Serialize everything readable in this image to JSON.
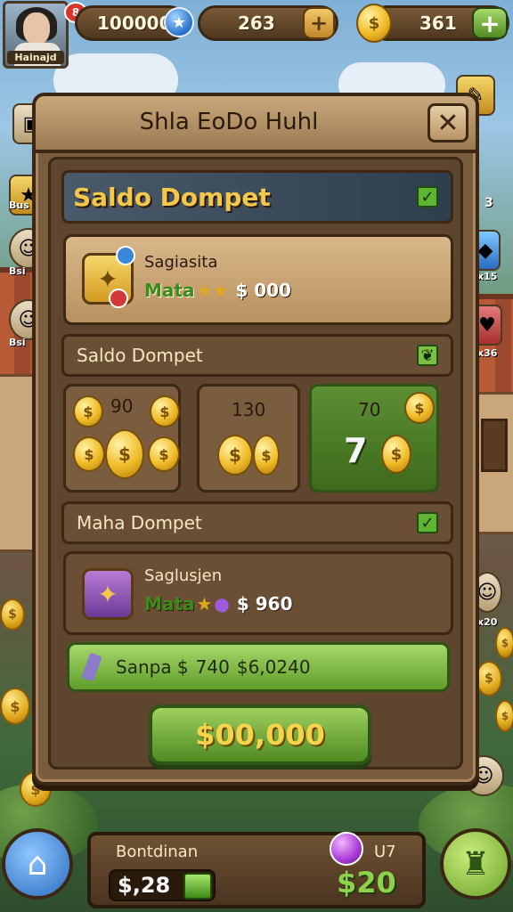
{
  "player": {
    "name": "Hainajd",
    "notification": "8"
  },
  "hud": {
    "currency_1": "100000",
    "currency_2": "263",
    "currency_3": "361",
    "add_label": "+"
  },
  "side_labels": {
    "left_1": "Bus",
    "left_2": "Bsi",
    "left_3": "Bsi",
    "right_1": "3",
    "right_2": "x15",
    "right_3": "x36",
    "right_4": "x20"
  },
  "panel": {
    "title": "Shla EoDo Huhl",
    "close_label": "✕"
  },
  "header_section": {
    "title": "Saldo Dompet"
  },
  "card_1": {
    "name": "Sagiasita",
    "sub_label": "Mata",
    "amount": "$ 000"
  },
  "section_2": {
    "title": "Saldo Dompet"
  },
  "packs": [
    {
      "value": "90"
    },
    {
      "value": "130"
    },
    {
      "value": "70",
      "big_value": "7"
    }
  ],
  "section_3": {
    "title": "Maha Dompet"
  },
  "card_2": {
    "name": "Saglusjen",
    "sub_label": "Mata",
    "amount": "$ 960"
  },
  "summary_bar": {
    "label": "Sanpa $",
    "value_1": "740",
    "value_2": "$6,0240"
  },
  "confirm_button": {
    "label": "$00,000"
  },
  "bottom": {
    "label": "Bontdinan",
    "balance": "$,28",
    "badge": "U7",
    "reward": "$20"
  },
  "colors": {
    "accent_green": "#5f9d2a",
    "gold": "#f0bb27",
    "wood": "#7a5c3f"
  }
}
